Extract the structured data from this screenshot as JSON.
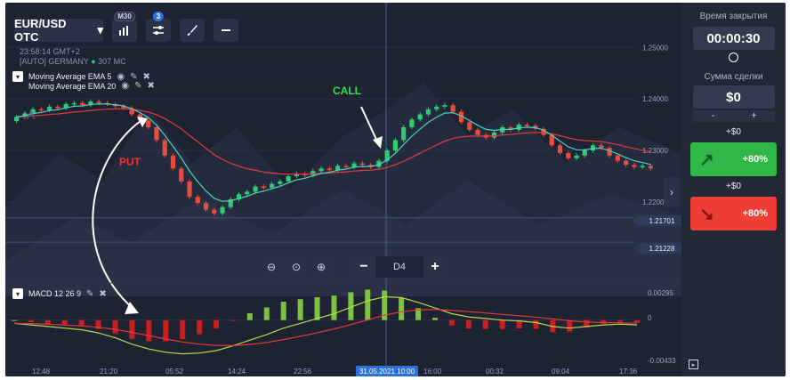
{
  "toolbar": {
    "pair_label": "EUR/USD OTC",
    "pair_chevron": "chevron-down-icon",
    "timeframe_badge": "M30",
    "indicator_count": "3",
    "chart_type_icon": "bars-icon",
    "indicators_icon": "sliders-icon",
    "draw_icon": "brush-icon",
    "minus_icon": "minus-icon"
  },
  "meta": {
    "time": "23:58:14 GMT+2",
    "server": "[AUTO] GERMANY",
    "ping": "307 MC"
  },
  "indicators": [
    {
      "label": "Moving Average EMA 5"
    },
    {
      "label": "Moving Average EMA 20"
    }
  ],
  "macd": {
    "label": "MACD 12 26 9"
  },
  "watermark": "A",
  "annotations": {
    "put": "PUT",
    "call": "CALL"
  },
  "price_axis": [
    "1.25000",
    "1.24000",
    "1.23000",
    "1.22000"
  ],
  "price_badges": [
    "1.21701",
    "1.21228"
  ],
  "macd_axis": [
    "0.00295",
    "0",
    "-0.00433"
  ],
  "time_axis": [
    "12:48",
    "21:20",
    "05:52",
    "14:24",
    "22:56",
    "31.05.2021 10:00",
    "16:00",
    "00:32",
    "09:04",
    "17:36"
  ],
  "zoom": {
    "out_icon": "zoom-out-icon",
    "fit_icon": "zoom-fit-icon",
    "in_icon": "zoom-in-icon"
  },
  "timeframe": {
    "minus": "−",
    "label": "D4",
    "plus": "+"
  },
  "panel": {
    "expiry_label": "Время закрытия",
    "expiry_value": "00:00:30",
    "amount_label": "Сумма сделки",
    "amount_value": "$0",
    "amount_minus": "-",
    "amount_plus": "+",
    "profit_top": "+$0",
    "call_pct": "+80%",
    "profit_mid": "+$0",
    "put_pct": "+80%"
  },
  "colors": {
    "bull": "#2ecc71",
    "bear": "#e74c3c",
    "ema5": "#49d1c4",
    "ema20": "#e23b3b",
    "call_button": "#2fb847",
    "put_button": "#ef3e36",
    "accent": "#2c71d8"
  },
  "chart_data": {
    "type": "candlestick",
    "pair": "EUR/USD OTC",
    "ylim": [
      1.2155,
      1.2535
    ],
    "price_ticks": [
      1.25,
      1.24,
      1.23,
      1.22
    ],
    "marked_levels": [
      1.21701,
      1.21228
    ],
    "close_series": [
      1.2365,
      1.2372,
      1.238,
      1.2378,
      1.2385,
      1.2382,
      1.239,
      1.2392,
      1.2388,
      1.2395,
      1.2392,
      1.239,
      1.2386,
      1.2382,
      1.237,
      1.2358,
      1.2345,
      1.232,
      1.229,
      1.2265,
      1.224,
      1.221,
      1.2198,
      1.2185,
      1.2178,
      1.219,
      1.2205,
      1.2215,
      1.222,
      1.223,
      1.2228,
      1.2235,
      1.224,
      1.225,
      1.2255,
      1.2252,
      1.226,
      1.2265,
      1.2262,
      1.227,
      1.2268,
      1.2275,
      1.2272,
      1.2268,
      1.228,
      1.23,
      1.232,
      1.2345,
      1.236,
      1.237,
      1.238,
      1.2385,
      1.2388,
      1.2375,
      1.2355,
      1.234,
      1.233,
      1.2325,
      1.2335,
      1.2345,
      1.234,
      1.235,
      1.2348,
      1.2342,
      1.233,
      1.231,
      1.2295,
      1.2285,
      1.229,
      1.23,
      1.231,
      1.2305,
      1.229,
      1.228,
      1.2272,
      1.2268,
      1.227,
      1.2265
    ],
    "macd_series": [
      -0.0004,
      -0.0006,
      -0.0008,
      -0.001,
      -0.0012,
      -0.0016,
      -0.0022,
      -0.003,
      -0.0036,
      -0.004,
      -0.0042,
      -0.0041,
      -0.0038,
      -0.0032,
      -0.0025,
      -0.0018,
      -0.001,
      -0.0004,
      0.0002,
      0.0008,
      0.0016,
      0.0024,
      0.0029,
      0.0028,
      0.0022,
      0.0015,
      0.0008,
      0.0004,
      0.0002,
      0.0,
      -0.0001,
      -0.0003,
      -0.0008,
      -0.001,
      -0.0008,
      -0.0006,
      -0.0005,
      -0.0006
    ],
    "macd_ylim": [
      -0.0048,
      0.0034
    ]
  }
}
